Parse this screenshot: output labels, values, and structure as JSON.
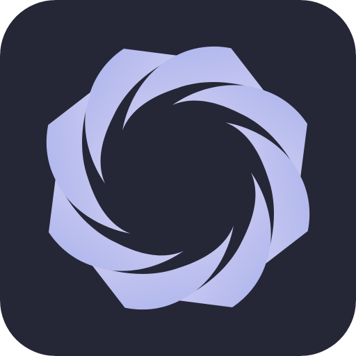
{
  "app_icon": {
    "icon_name": "aperture-flower-icon",
    "background_color": "#252736",
    "gradient_start": "#A9B3EB",
    "gradient_end": "#E1D8F6",
    "petal_count": 8
  }
}
